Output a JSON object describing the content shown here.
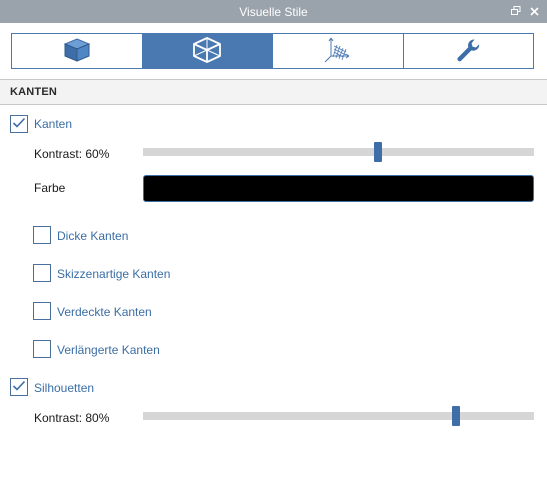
{
  "window": {
    "title": "Visuelle Stile",
    "restore_icon": "restore-window-icon",
    "close_icon": "close-icon"
  },
  "tabs": [
    {
      "icon": "solid-cube-icon",
      "active": false
    },
    {
      "icon": "wireframe-cube-icon",
      "active": true
    },
    {
      "icon": "axes-grid-icon",
      "active": false
    },
    {
      "icon": "wrench-icon",
      "active": false
    }
  ],
  "section": {
    "title": "KANTEN"
  },
  "edges": {
    "checkbox_label": "Kanten",
    "checked": true,
    "contrast_label": "Kontrast: 60%",
    "contrast_value": 0.6,
    "color_label": "Farbe",
    "color_value": "#000000"
  },
  "options": [
    {
      "label": "Dicke Kanten",
      "checked": false
    },
    {
      "label": "Skizzenartige Kanten",
      "checked": false
    },
    {
      "label": "Verdeckte Kanten",
      "checked": false
    },
    {
      "label": "Verlängerte Kanten",
      "checked": false
    }
  ],
  "silhouettes": {
    "checkbox_label": "Silhouetten",
    "checked": true,
    "contrast_label": "Kontrast: 80%",
    "contrast_value": 0.8
  },
  "colors": {
    "accent": "#4a78b0",
    "label_blue": "#3a6ea5",
    "title_bar": "#9aa3ab"
  }
}
